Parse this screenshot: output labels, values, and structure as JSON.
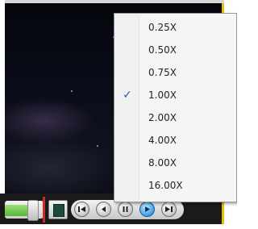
{
  "speed_menu": {
    "selected": "1.00X",
    "check_glyph": "✓",
    "items": [
      {
        "label": "0.25X",
        "checked": false
      },
      {
        "label": "0.50X",
        "checked": false
      },
      {
        "label": "0.75X",
        "checked": false
      },
      {
        "label": "1.00X",
        "checked": true
      },
      {
        "label": "2.00X",
        "checked": false
      },
      {
        "label": "4.00X",
        "checked": false
      },
      {
        "label": "8.00X",
        "checked": false
      },
      {
        "label": "16.00X",
        "checked": false
      }
    ]
  },
  "player_controls": {
    "buttons": [
      {
        "name": "previous-icon"
      },
      {
        "name": "rewind-icon"
      },
      {
        "name": "pause-icon"
      },
      {
        "name": "play-icon",
        "active": true
      },
      {
        "name": "next-icon"
      }
    ],
    "colors": {
      "frame_border": "#e8c000",
      "volume_fill": "#5ab33a",
      "separator": "#cc2b2b",
      "active_button": "#3aa0e8"
    }
  }
}
